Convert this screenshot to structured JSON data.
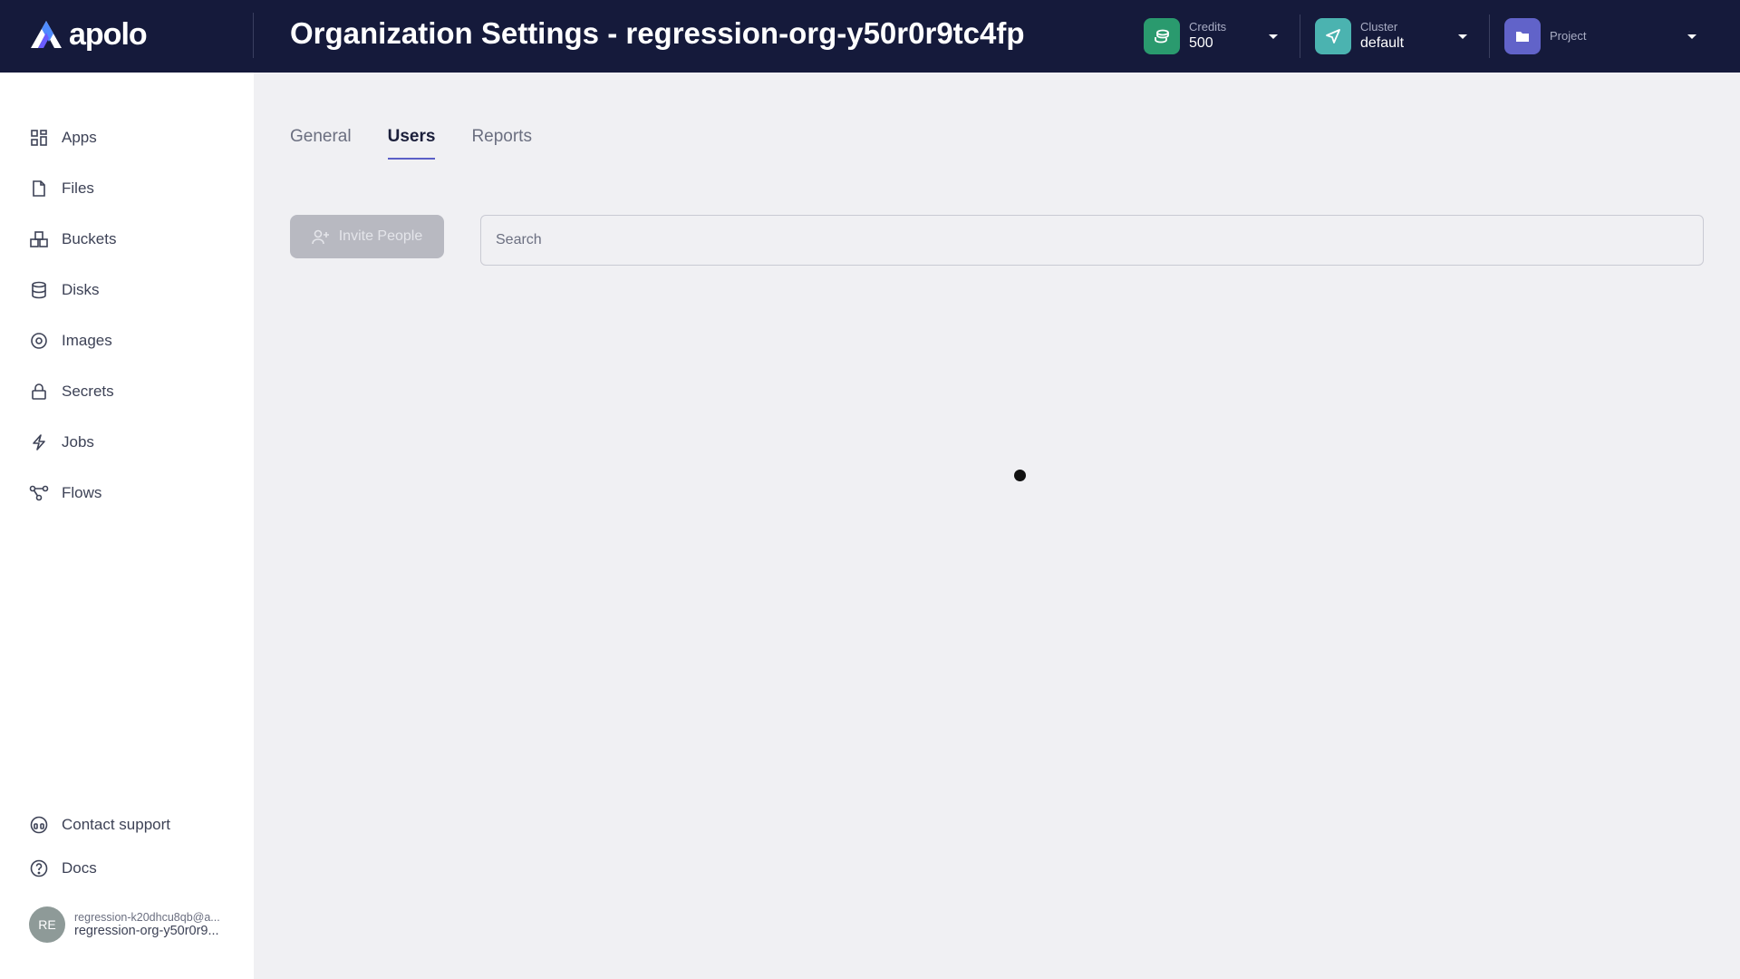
{
  "app": {
    "logo_text": "apolo",
    "page_title": "Organization Settings - regression-org-y50r0r9tc4fp"
  },
  "header": {
    "credits": {
      "label": "Credits",
      "value": "500",
      "icon": "coins-icon",
      "color": "#2a9a6e"
    },
    "cluster": {
      "label": "Cluster",
      "value": "default",
      "icon": "send-icon",
      "color": "#4bb3b0"
    },
    "project": {
      "label": "Project",
      "value": "",
      "icon": "folder-icon",
      "color": "#6163c9"
    }
  },
  "sidebar": {
    "items": [
      {
        "label": "Apps",
        "icon": "apps-grid-icon"
      },
      {
        "label": "Files",
        "icon": "file-icon"
      },
      {
        "label": "Buckets",
        "icon": "buckets-icon"
      },
      {
        "label": "Disks",
        "icon": "database-icon"
      },
      {
        "label": "Images",
        "icon": "image-disc-icon"
      },
      {
        "label": "Secrets",
        "icon": "lock-icon"
      },
      {
        "label": "Jobs",
        "icon": "lightning-icon"
      },
      {
        "label": "Flows",
        "icon": "flow-icon"
      }
    ],
    "footer": [
      {
        "label": "Contact support",
        "icon": "headset-icon"
      },
      {
        "label": "Docs",
        "icon": "help-circle-icon"
      }
    ],
    "user": {
      "initials": "RE",
      "email": "regression-k20dhcu8qb@a...",
      "org": "regression-org-y50r0r9..."
    }
  },
  "main": {
    "tabs": [
      {
        "label": "General",
        "active": false
      },
      {
        "label": "Users",
        "active": true
      },
      {
        "label": "Reports",
        "active": false
      }
    ],
    "invite_label": "Invite People",
    "search_placeholder": "Search",
    "search_value": ""
  },
  "colors": {
    "header_bg": "#151a3b",
    "accent": "#5b5fc7",
    "page_bg": "#f0f0f3"
  }
}
